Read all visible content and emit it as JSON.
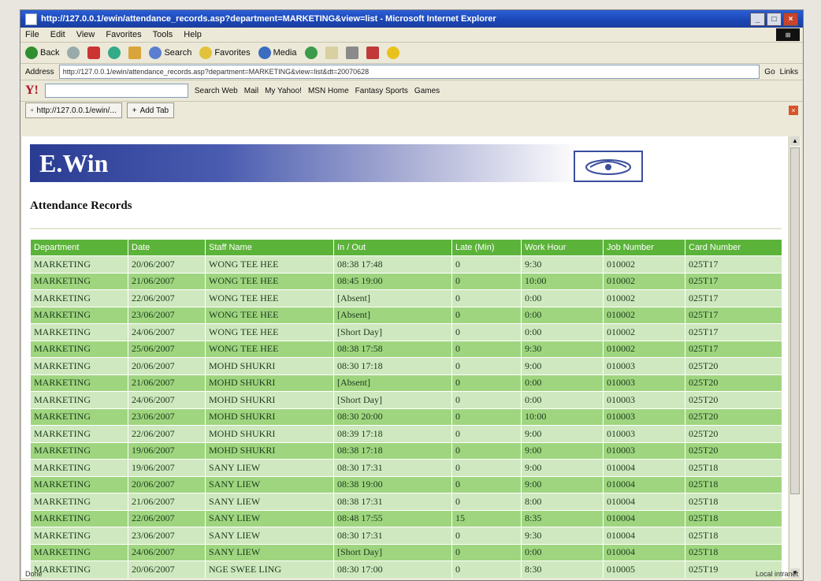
{
  "window": {
    "title": "http://127.0.0.1/ewin/attendance_records.asp?department=MARKETING&view=list - Microsoft Internet Explorer",
    "controls": [
      "_",
      "□",
      "×"
    ]
  },
  "menubar": {
    "items": [
      "File",
      "Edit",
      "View",
      "Favorites",
      "Tools",
      "Help"
    ]
  },
  "toolbar": {
    "back": "Back",
    "forward": "",
    "search": "Search",
    "favorites": "Favorites",
    "media": "Media"
  },
  "address": {
    "label": "Address",
    "url": "http://127.0.0.1/ewin/attendance_records.asp?department=MARKETING&view=list&dt=20070628",
    "go": "Go",
    "links": "Links"
  },
  "yahoo_bar": {
    "logo": "Y!",
    "search_web": "Search Web",
    "items": [
      "Mail",
      "My Yahoo!",
      "MSN Home",
      "Fantasy Sports",
      "Games"
    ]
  },
  "tabs": {
    "active": "http://127.0.0.1/ewin/...",
    "add": "Add Tab"
  },
  "page": {
    "brand": "E.Win",
    "heading": "Attendance Records"
  },
  "table": {
    "columns": [
      "Department",
      "Date",
      "Staff Name",
      "In / Out",
      "Late (Min)",
      "Work Hour",
      "Job Number",
      "Card Number"
    ],
    "rows": [
      [
        "MARKETING",
        "20/06/2007",
        "WONG TEE HEE",
        "08:38 17:48",
        "0",
        "9:30",
        "010002",
        "025T17"
      ],
      [
        "MARKETING",
        "21/06/2007",
        "WONG TEE HEE",
        "08:45 19:00",
        "0",
        "10:00",
        "010002",
        "025T17"
      ],
      [
        "MARKETING",
        "22/06/2007",
        "WONG TEE HEE",
        "[Absent]",
        "0",
        "0:00",
        "010002",
        "025T17"
      ],
      [
        "MARKETING",
        "23/06/2007",
        "WONG TEE HEE",
        "[Absent]",
        "0",
        "0:00",
        "010002",
        "025T17"
      ],
      [
        "MARKETING",
        "24/06/2007",
        "WONG TEE HEE",
        "[Short Day]",
        "0",
        "0:00",
        "010002",
        "025T17"
      ],
      [
        "MARKETING",
        "25/06/2007",
        "WONG TEE HEE",
        "08:38 17:58",
        "0",
        "9:30",
        "010002",
        "025T17"
      ],
      [
        "MARKETING",
        "20/06/2007",
        "MOHD SHUKRI",
        "08:30 17:18",
        "0",
        "9:00",
        "010003",
        "025T20"
      ],
      [
        "MARKETING",
        "21/06/2007",
        "MOHD SHUKRI",
        "[Absent]",
        "0",
        "0:00",
        "010003",
        "025T20"
      ],
      [
        "MARKETING",
        "24/06/2007",
        "MOHD SHUKRI",
        "[Short Day]",
        "0",
        "0:00",
        "010003",
        "025T20"
      ],
      [
        "MARKETING",
        "23/06/2007",
        "MOHD SHUKRI",
        "08:30 20:00",
        "0",
        "10:00",
        "010003",
        "025T20"
      ],
      [
        "MARKETING",
        "22/06/2007",
        "MOHD SHUKRI",
        "08:39 17:18",
        "0",
        "9:00",
        "010003",
        "025T20"
      ],
      [
        "MARKETING",
        "19/06/2007",
        "MOHD SHUKRI",
        "08:38 17:18",
        "0",
        "9:00",
        "010003",
        "025T20"
      ],
      [
        "MARKETING",
        "19/06/2007",
        "SANY LIEW",
        "08:30 17:31",
        "0",
        "9:00",
        "010004",
        "025T18"
      ],
      [
        "MARKETING",
        "20/06/2007",
        "SANY LIEW",
        "08:38 19:00",
        "0",
        "9:00",
        "010004",
        "025T18"
      ],
      [
        "MARKETING",
        "21/06/2007",
        "SANY LIEW",
        "08:38 17:31",
        "0",
        "8:00",
        "010004",
        "025T18"
      ],
      [
        "MARKETING",
        "22/06/2007",
        "SANY LIEW",
        "08:48 17:55",
        "15",
        "8:35",
        "010004",
        "025T18"
      ],
      [
        "MARKETING",
        "23/06/2007",
        "SANY LIEW",
        "08:30 17:31",
        "0",
        "9:30",
        "010004",
        "025T18"
      ],
      [
        "MARKETING",
        "24/06/2007",
        "SANY LIEW",
        "[Short Day]",
        "0",
        "0:00",
        "010004",
        "025T18"
      ],
      [
        "MARKETING",
        "20/06/2007",
        "NGE SWEE LING",
        "08:30 17:00",
        "0",
        "8:30",
        "010005",
        "025T19"
      ]
    ]
  },
  "status": {
    "text": "Done",
    "zone": "Local intranet"
  },
  "colors": {
    "header_green": "#5cb33a",
    "row_light": "#cfe8bf",
    "row_dark": "#9fd57f",
    "banner_blue": "#2a3c92"
  }
}
